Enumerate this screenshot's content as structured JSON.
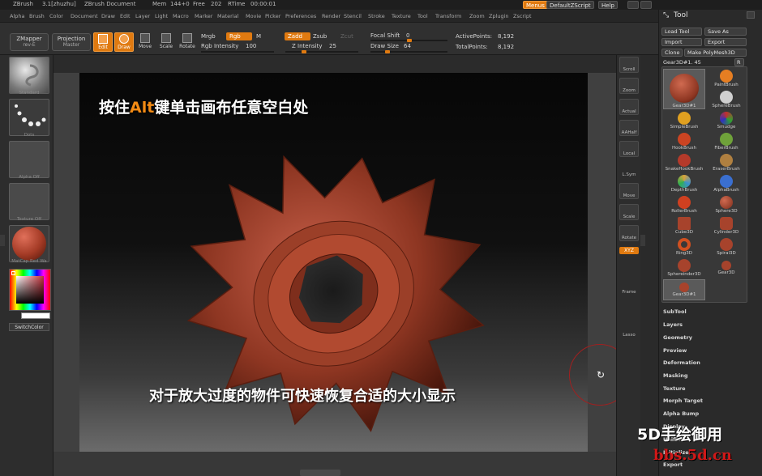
{
  "titlebar": {
    "app": "ZBrush",
    "version": "3.1[zhuzhu]",
    "document": "ZBrush Document",
    "mem": "Mem",
    "mem_value": "144+0",
    "free": "Free",
    "free_value": "202",
    "rtime": "RTime",
    "rtime_value": "00:00:01",
    "menus_btn": "Menus",
    "script_btn": "DefaultZScript",
    "help_btn": "Help"
  },
  "menubar": [
    "Alpha",
    "Brush",
    "Color",
    "Document",
    "Draw",
    "Edit",
    "Layer",
    "Light",
    "Macro",
    "Marker",
    "Material",
    "Movie",
    "Picker",
    "Preferences",
    "Render",
    "Stencil",
    "Stroke",
    "Texture",
    "Tool",
    "Transform",
    "Zoom",
    "Zplugin",
    "Zscript"
  ],
  "toolbar": {
    "zmapper": "ZMapper",
    "zmapper_sub": "rev-E",
    "projection": "Projection",
    "projection_sub": "Master",
    "edit": "Edit",
    "draw": "Draw",
    "move": "Move",
    "scale": "Scale",
    "rotate": "Rotate",
    "mrgb": "Mrgb",
    "rgb": "Rgb",
    "m": "M",
    "rgb_intensity": "Rgb Intensity",
    "rgb_intensity_value": "100",
    "zadd": "Zadd",
    "zsub": "Zsub",
    "zcut": "Zcut",
    "z_intensity": "Z Intensity",
    "z_intensity_value": "25",
    "focal_shift": "Focal Shift",
    "focal_shift_value": "0",
    "draw_size": "Draw Size",
    "draw_size_value": "64",
    "active_points": "ActivePoints:",
    "active_points_value": "8,192",
    "total_points": "TotalPoints:",
    "total_points_value": "8,192"
  },
  "leftshelf": {
    "standard": "Standard",
    "dots": "Dots",
    "alpha": "Alpha Off",
    "texture": "Texture Off",
    "matcap": "MatCap Red Wa",
    "switchcolor": "SwitchColor"
  },
  "canvas": {
    "caption_top_pre": "按住",
    "caption_top_key": "Alt",
    "caption_top_post": "键单击画布任意空白处",
    "caption_bottom": "对于放大过度的物件可快速恢复合适的大小显示"
  },
  "rightstrip": [
    "Scroll",
    "Zoom",
    "Actual",
    "AAHalf",
    "Local",
    "L.Sym",
    "Move",
    "Scale",
    "Rotate",
    "Frame",
    "Lasso"
  ],
  "rightstrip_xyz": "XYZ",
  "toolpanel": {
    "title": "Tool",
    "load_tool": "Load Tool",
    "save_as": "Save As",
    "import": "Import",
    "export": "Export",
    "clone": "Clone",
    "make_polymesh": "Make PolyMesh3D",
    "current_tool": "Gear3D#1. 45",
    "r_btn": "R",
    "brushes": [
      {
        "name": "Gear3D#1",
        "color": "#a7432c"
      },
      {
        "name": "PaintBrush",
        "color": "#e67e22"
      },
      {
        "name": "SphereBrush",
        "color": "#d0d0d0"
      },
      {
        "name": "SimpleBrush",
        "color": "#e0a020"
      },
      {
        "name": "Smudge",
        "color": "#c03030"
      },
      {
        "name": "HookBrush",
        "color": "#cc4422"
      },
      {
        "name": "FiberBrush",
        "color": "#6fa23a"
      },
      {
        "name": "SnakeHookBrush",
        "color": "#b53a2a"
      },
      {
        "name": "EraserBrush",
        "color": "#b08040"
      },
      {
        "name": "DepthBrush",
        "color": "#d9a33b"
      },
      {
        "name": "AlphaBrush",
        "color": "#3a6fd0"
      },
      {
        "name": "RollerBrush",
        "color": "#d04020"
      },
      {
        "name": "Sphere3D",
        "color": "#a7432c"
      },
      {
        "name": "Cube3D",
        "color": "#a7432c"
      },
      {
        "name": "Cylinder3D",
        "color": "#a7432c"
      },
      {
        "name": "Ring3D",
        "color": "#d05020"
      },
      {
        "name": "Spiral3D",
        "color": "#a7432c"
      },
      {
        "name": "Sphereinder3D",
        "color": "#a7432c"
      },
      {
        "name": "Gear3D",
        "color": "#a7432c"
      },
      {
        "name": "Gear3D#1",
        "color": "#a7432c"
      }
    ],
    "subpalettes": [
      "SubTool",
      "Layers",
      "Geometry",
      "Preview",
      "Deformation",
      "Masking",
      "Texture",
      "Morph Target",
      "Alpha Bump",
      "Display",
      "Unified",
      "Initialize",
      "Export"
    ]
  },
  "watermark": {
    "line1": "5D手绘御用",
    "line2": "bbs.5d.cn"
  },
  "colors": {
    "accent": "#e07a10",
    "gear": "#a7432c",
    "highlight_text": "#f28a14"
  }
}
